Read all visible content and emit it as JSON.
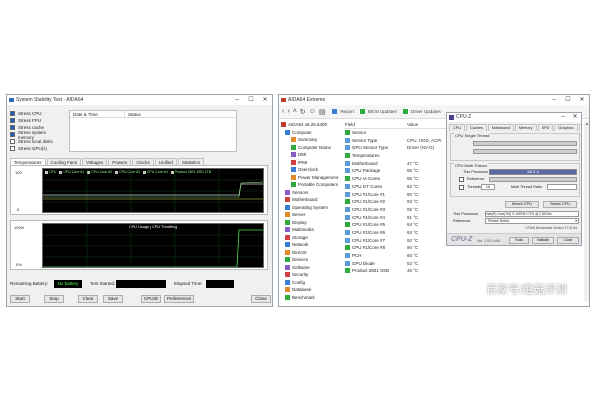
{
  "stability": {
    "title": "System Stability Test - AIDA64",
    "stress_options": [
      {
        "label": "Stress CPU",
        "checked": true
      },
      {
        "label": "Stress FPU",
        "checked": true
      },
      {
        "label": "Stress cache",
        "checked": true
      },
      {
        "label": "Stress system memory",
        "checked": true
      },
      {
        "label": "Stress local disks",
        "checked": false
      },
      {
        "label": "Stress GPU(s)",
        "checked": false
      }
    ],
    "log_headers": [
      "Date & Time",
      "Status"
    ],
    "tabs": [
      "Temperatures",
      "Cooling Fans",
      "Voltages",
      "Powers",
      "Clocks",
      "Unified",
      "Statistics"
    ],
    "temp_legend": [
      "CPU",
      "CPU Core #1",
      "CPU Core #2",
      "CPU Core #3",
      "CPU Core #4",
      "Product 2501 SSD 1TB"
    ],
    "temp_y_top": "100",
    "temp_y_bottom": "0",
    "cpu_graph_title": "CPU Usage | CPU Throttling",
    "cpu_y_top": "100%",
    "cpu_y_bottom": "0%",
    "status": {
      "battery_label": "Remaining Battery:",
      "battery_value": "No battery",
      "started_label": "Test Started:",
      "elapsed_label": "Elapsed Time:"
    },
    "buttons": [
      "Start",
      "Stop",
      "Clear",
      "Save",
      "CPUID",
      "Preferences",
      "Close"
    ]
  },
  "hwinfo": {
    "title": "AIDA64 Extreme",
    "toolbar": [
      "Report",
      "BIOS Updates",
      "Driver Updates"
    ],
    "tree_root": "AIDA64 v6.25.5400",
    "tree": [
      "Computer",
      "Summary",
      "Computer Name",
      "DMI",
      "IPMI",
      "Overclock",
      "Power Management",
      "Portable Computers",
      "Sensors",
      "Motherboard",
      "Operating System",
      "Server",
      "Display",
      "Multimedia",
      "Storage",
      "Network",
      "DirectX",
      "Devices",
      "Software",
      "Security",
      "Config",
      "Database",
      "Benchmark"
    ],
    "list_header": [
      "Field",
      "Value"
    ],
    "list": [
      {
        "field": "Sensor",
        "value": ""
      },
      {
        "field": "Sensor Type",
        "value": "CPU, HDD, ACPI"
      },
      {
        "field": "GPU Sensor Type",
        "value": "Driver (NV-D)"
      },
      {
        "field": "Temperatures",
        "value": ""
      },
      {
        "field": "Motherboard",
        "value": "47 °C"
      },
      {
        "field": "CPU Package",
        "value": "95 °C"
      },
      {
        "field": "CPU IA Cores",
        "value": "95 °C"
      },
      {
        "field": "CPU GT Cores",
        "value": "62 °C"
      },
      {
        "field": "CPU #1/Core #1",
        "value": "90 °C"
      },
      {
        "field": "CPU #1/Core #2",
        "value": "93 °C"
      },
      {
        "field": "CPU #1/Core #3",
        "value": "95 °C"
      },
      {
        "field": "CPU #1/Core #4",
        "value": "91 °C"
      },
      {
        "field": "CPU #1/Core #5",
        "value": "94 °C"
      },
      {
        "field": "CPU #1/Core #6",
        "value": "93 °C"
      },
      {
        "field": "CPU #1/Core #7",
        "value": "92 °C"
      },
      {
        "field": "CPU #1/Core #8",
        "value": "90 °C"
      },
      {
        "field": "PCH",
        "value": "60 °C"
      },
      {
        "field": "GPU Diode",
        "value": "53 °C"
      },
      {
        "field": "Product 2501 SSD",
        "value": "46 °C"
      }
    ]
  },
  "cpuz": {
    "title": "CPU-Z",
    "tabs": [
      "CPU",
      "Caches",
      "Mainboard",
      "Memory",
      "SPD",
      "Graphics",
      "Bench",
      "About"
    ],
    "active_tab": "Bench",
    "single_group": "CPU Single Thread",
    "this_processor": "This Processor",
    "multi_group": "CPU Multi Thread",
    "multi_value": "5401.8",
    "reference_label": "Reference",
    "threads_label": "Threads",
    "threads_value": "16",
    "ratio_label": "Multi Thread Ratio",
    "bench_cpu_label": "Bench CPU",
    "stress_cpu_label": "Stress CPU",
    "this_processor_label": "This Processor",
    "processor_name": "Intel(R) Core(TM) i7-10875H CPU @ 2.30GHz",
    "reference_select_label": "Reference",
    "reference_select_value": "Please Select",
    "benchmark_version": "CPUID Benchmark Version 17.01.64",
    "logo": "CPU-Z",
    "version": "Ver. 1.92.0.x64",
    "buttons": [
      "Tools",
      "Validate",
      "Close"
    ]
  },
  "watermark": "百家号/蘑菇评测"
}
